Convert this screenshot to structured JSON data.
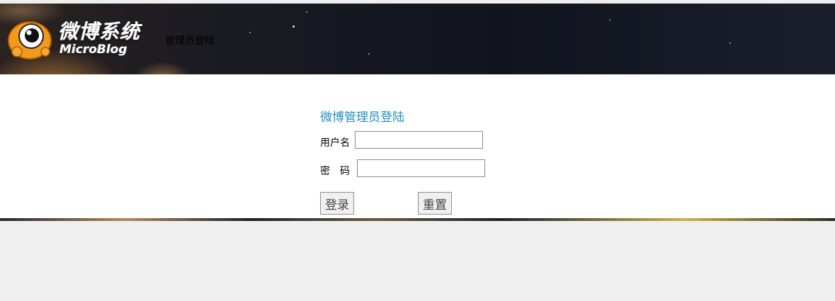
{
  "header": {
    "logo_title": "微博系统",
    "logo_subtitle": "MicroBlog",
    "section_label": "管理员登陆"
  },
  "login": {
    "title": "微博管理员登陆",
    "username_label": "用户名",
    "username_value": "",
    "password_label": "密　码",
    "password_value": "",
    "submit_label": "登录",
    "reset_label": "重置"
  },
  "colors": {
    "title_accent": "#1f8fc2",
    "logo_orange": "#f39a1e"
  }
}
